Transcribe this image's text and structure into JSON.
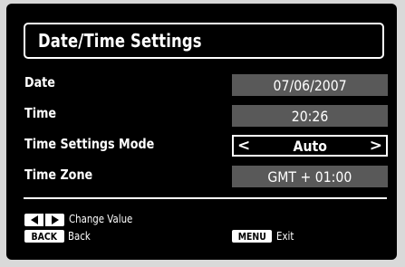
{
  "title": "Date/Time Settings",
  "rows": [
    {
      "label": "Date",
      "value": "07/06/2007"
    },
    {
      "label": "Time",
      "value": "20:26"
    },
    {
      "label": "Time Settings Mode",
      "value": "Auto"
    },
    {
      "label": "Time Zone",
      "value": "GMT + 01:00"
    }
  ],
  "hints": {
    "change_value": "Change Value",
    "back_key": "BACK",
    "back_text": "Back",
    "menu_key": "MENU",
    "exit_text": "Exit"
  },
  "icons": {
    "left_arrow": "<",
    "right_arrow": ">"
  },
  "colors": {
    "background": "#000000",
    "value_box": "#595959",
    "text": "#ffffff"
  }
}
